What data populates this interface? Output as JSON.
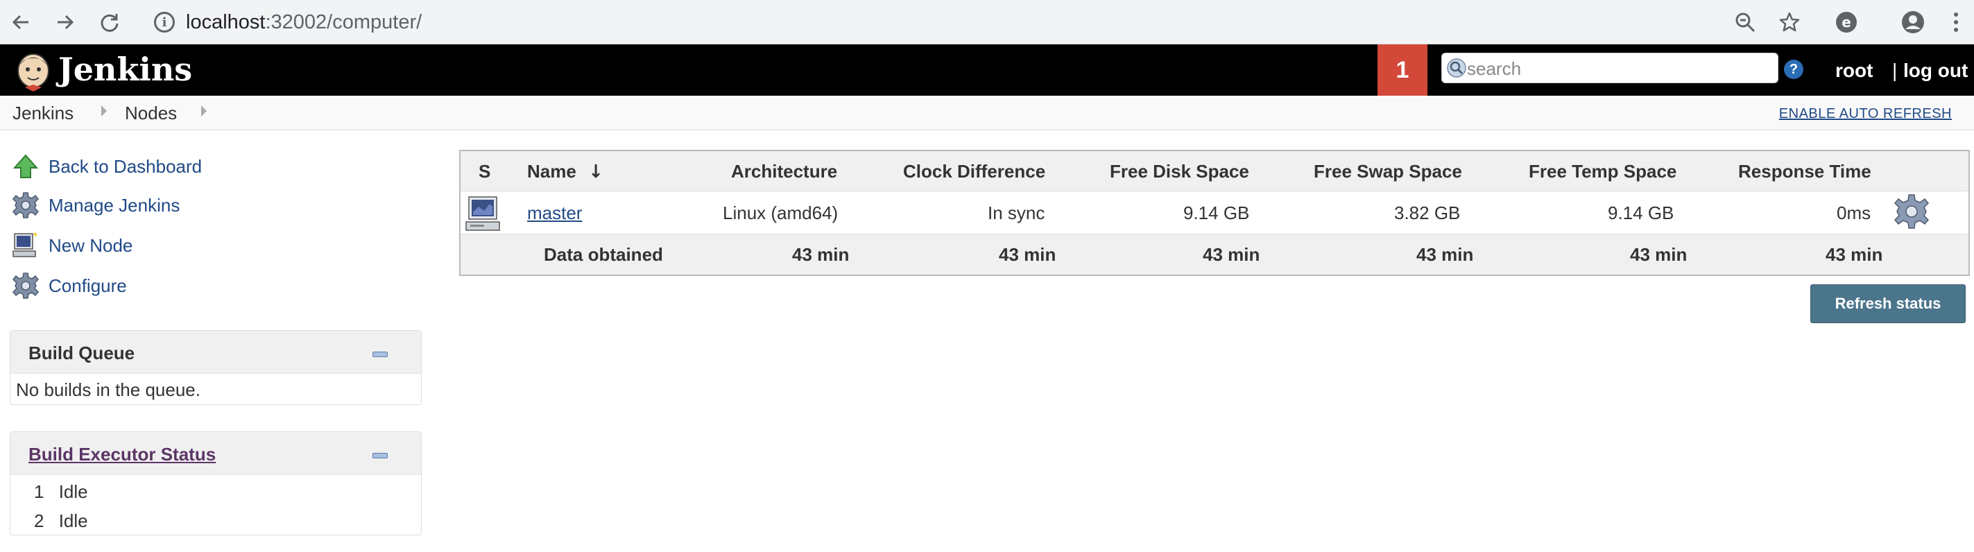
{
  "browser": {
    "url_host": "localhost",
    "url_rest": ":32002/computer/",
    "icons": [
      "back-arrow-icon",
      "forward-arrow-icon",
      "reload-icon",
      "info-icon",
      "zoom-icon",
      "star-icon",
      "extension-icon",
      "profile-icon",
      "menu-icon"
    ]
  },
  "header": {
    "title": "Jenkins",
    "notification_count": "1",
    "search_placeholder": "search",
    "help_label": "?",
    "user": "root",
    "separator": "|",
    "logout": "log out",
    "colors": {
      "bar": "#000000",
      "badge": "#d24939"
    }
  },
  "breadcrumbs": {
    "items": [
      "Jenkins",
      "Nodes"
    ],
    "auto_refresh": "ENABLE AUTO REFRESH"
  },
  "sidebar": {
    "tasks": [
      {
        "label": "Back to Dashboard",
        "icon": "up-arrow-icon"
      },
      {
        "label": "Manage Jenkins",
        "icon": "gear-icon"
      },
      {
        "label": "New Node",
        "icon": "computer-icon"
      },
      {
        "label": "Configure",
        "icon": "gear-icon"
      }
    ],
    "build_queue": {
      "title": "Build Queue",
      "message": "No builds in the queue."
    },
    "executors": {
      "title": "Build Executor Status",
      "items": [
        {
          "num": "1",
          "status": "Idle"
        },
        {
          "num": "2",
          "status": "Idle"
        }
      ]
    }
  },
  "table": {
    "headers": {
      "s": "S",
      "name": "Name",
      "sort_arrow": "↓",
      "architecture": "Architecture",
      "clock": "Clock Difference",
      "disk": "Free Disk Space",
      "swap": "Free Swap Space",
      "temp": "Free Temp Space",
      "response": "Response Time"
    },
    "rows": [
      {
        "name": "master",
        "architecture": "Linux (amd64)",
        "clock": "In sync",
        "disk": "9.14 GB",
        "swap": "3.82 GB",
        "temp": "9.14 GB",
        "response": "0ms"
      }
    ],
    "footer": {
      "label": "Data obtained",
      "architecture": "43 min",
      "clock": "43 min",
      "disk": "43 min",
      "swap": "43 min",
      "temp": "43 min",
      "response": "43 min"
    }
  },
  "actions": {
    "refresh": "Refresh status"
  }
}
